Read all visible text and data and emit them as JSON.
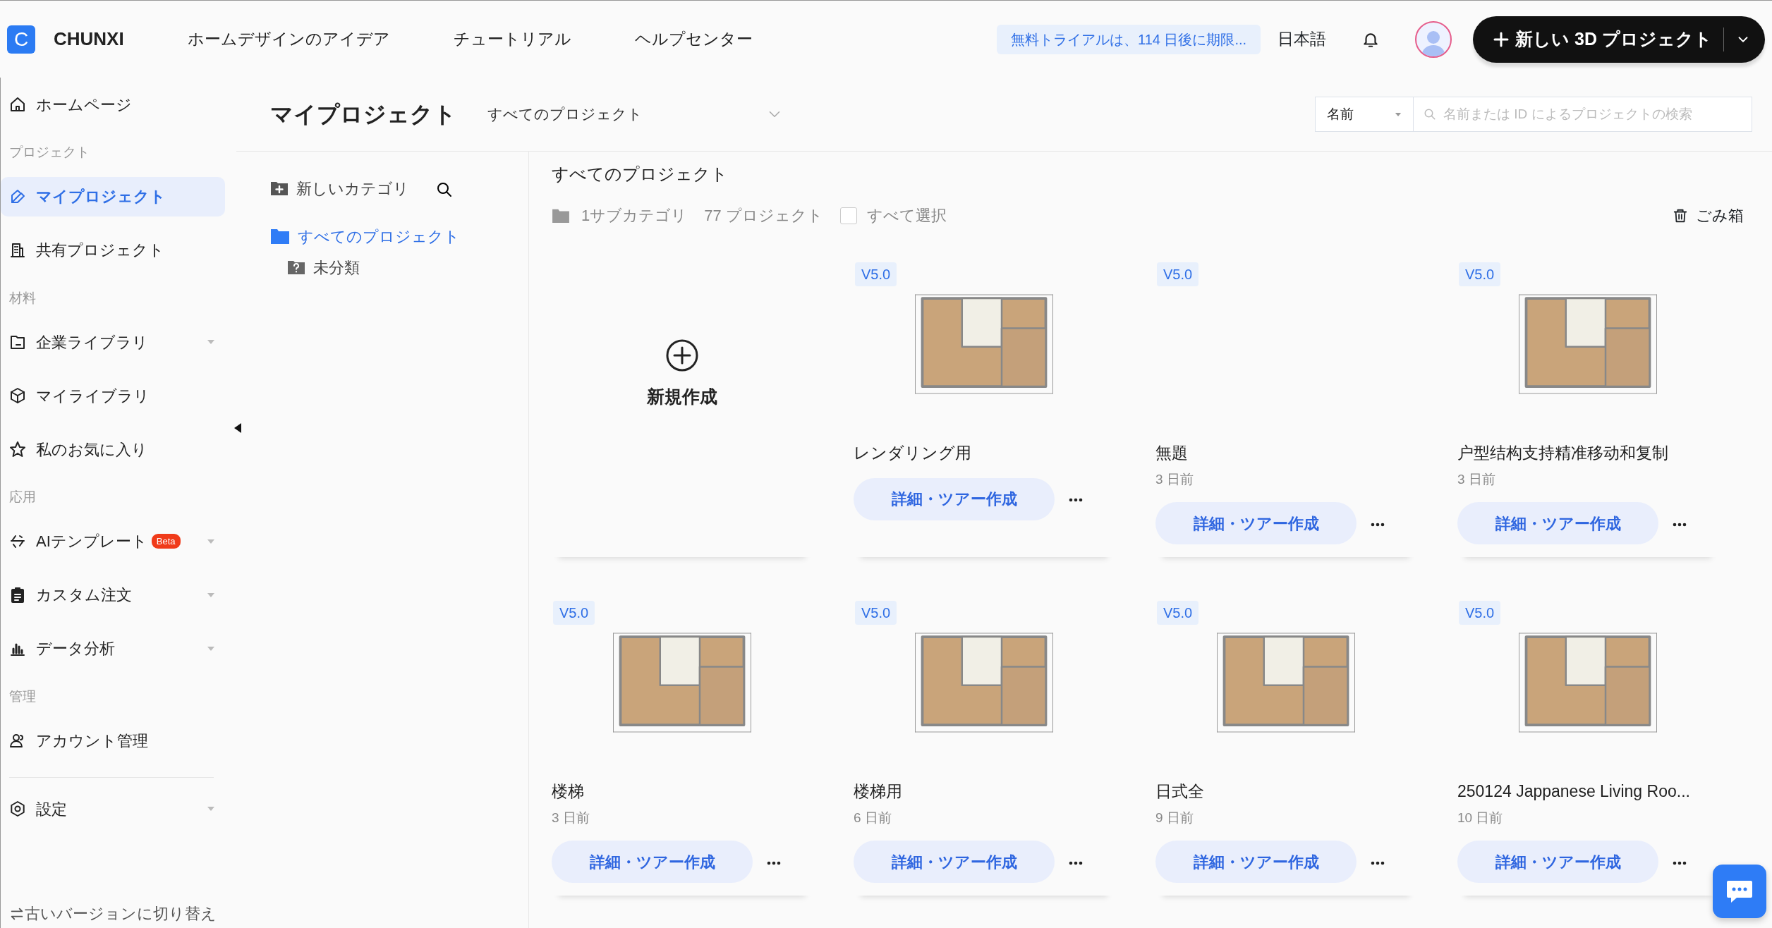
{
  "header": {
    "logo_letter": "C",
    "brand": "CHUNXI",
    "nav": [
      "ホームデザインのアイデア",
      "チュートリアル",
      "ヘルプセンター"
    ],
    "trial_notice": "無料トライアルは、114 日後に期限...",
    "language": "日本語",
    "new_project": "新しい 3D プロジェクト"
  },
  "sidebar": {
    "sections": [
      {
        "items": [
          {
            "label": "ホームページ",
            "selected": false,
            "expandable": false
          }
        ]
      },
      {
        "title": "プロジェクト",
        "items": [
          {
            "label": "マイプロジェクト",
            "selected": true,
            "expandable": false
          },
          {
            "label": "共有プロジェクト",
            "selected": false,
            "expandable": false
          }
        ]
      },
      {
        "title": "材料",
        "items": [
          {
            "label": "企業ライブラリ",
            "selected": false,
            "expandable": true
          },
          {
            "label": "マイライブラリ",
            "selected": false,
            "expandable": false
          },
          {
            "label": "私のお気に入り",
            "selected": false,
            "expandable": false
          }
        ]
      },
      {
        "title": "応用",
        "items": [
          {
            "label": "AIテンプレート",
            "selected": false,
            "expandable": true,
            "badge": "Beta"
          },
          {
            "label": "カスタム注文",
            "selected": false,
            "expandable": true
          },
          {
            "label": "データ分析",
            "selected": false,
            "expandable": true
          }
        ]
      },
      {
        "title": "管理",
        "items": [
          {
            "label": "アカウント管理",
            "selected": false,
            "expandable": false
          }
        ]
      },
      {
        "items": [
          {
            "label": "設定",
            "selected": false,
            "expandable": true
          }
        ]
      }
    ],
    "footer": "古いバージョンに切り替え"
  },
  "page_header": {
    "title": "マイプロジェクト",
    "filter": "すべてのプロジェクト",
    "sort": "名前",
    "search": {
      "placeholder": "名前または ID によるプロジェクトの検索"
    }
  },
  "categories": {
    "new_category": "新しいカテゴリ",
    "tree": [
      {
        "label": "すべてのプロジェクト",
        "selected": true,
        "children": [
          {
            "label": "未分類",
            "selected": false
          }
        ]
      }
    ]
  },
  "projects": {
    "heading": "すべてのプロジェクト",
    "subcategories": "1サブカテゴリ",
    "count": "77 プロジェクト",
    "select_all": {
      "label": "すべて選択",
      "checked": false
    },
    "trash": "ごみ箱",
    "items": [
      {
        "kind": "create",
        "label": "新規作成"
      },
      {
        "kind": "project",
        "version": "V5.0",
        "thumbnail": true,
        "title": "レンダリング用",
        "button": "詳細・ツアー作成"
      },
      {
        "kind": "project",
        "version": "V5.0",
        "thumbnail": false,
        "title": "無題",
        "date": "3 日前",
        "button": "詳細・ツアー作成"
      },
      {
        "kind": "project",
        "version": "V5.0",
        "thumbnail": true,
        "title": "户型结构支持精准移动和复制",
        "date": "3 日前",
        "button": "詳細・ツアー作成"
      },
      {
        "kind": "project",
        "version": "V5.0",
        "thumbnail": true,
        "title": "楼梯",
        "date": "3 日前",
        "button": "詳細・ツアー作成"
      },
      {
        "kind": "project",
        "version": "V5.0",
        "thumbnail": true,
        "title": "楼梯用",
        "date": "6 日前",
        "button": "詳細・ツアー作成"
      },
      {
        "kind": "project",
        "version": "V5.0",
        "thumbnail": true,
        "title": "日式全",
        "date": "9 日前",
        "button": "詳細・ツアー作成"
      },
      {
        "kind": "project",
        "version": "V5.0",
        "thumbnail": true,
        "title": "250124 Jappanese Living Roo...",
        "date": "10 日前",
        "button": "詳細・ツアー作成"
      }
    ]
  }
}
